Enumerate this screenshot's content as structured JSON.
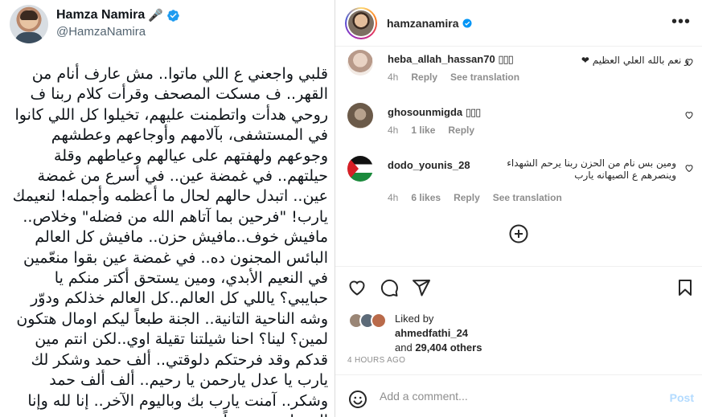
{
  "tweet": {
    "author_name": "Hamza Namira",
    "author_name_emoji": "🎤",
    "handle": "@HamzaNamira",
    "body": "قلبي واجعني ع اللي ماتوا.. مش عارف أنام من القهر.. ف مسكت المصحف وقرأت كلام ربنا ف روحي هدأت واتطمنت عليهم، تخيلوا كل اللي كانوا في المستشفى، بآلامهم وأوجاعهم وعطشهم وجوعهم ولهفتهم على عيالهم وعياطهم وقلة حيلتهم.. في غمضة عين.. في أسرع من غمضة عين.. اتبدل حالهم لحال ما أعظمه وأجمله! لنعيمك يارب! \"فرحين بما آتاهم الله من فضله\" وخلاص.. مافيش خوف..مافيش حزن.. مافيش كل العالم البائس المجنون ده.. في غمضة عين بقوا منعّمين في النعيم الأبدي، ومين يستحق أكتر منكم يا حبايبي؟ ياللي كل العالم..كل العالم خذلكم ودوّر وشه الناحية التانية.. الجنة طبعاً ليكم اومال هتكون لمين؟ لينا؟ احنا شيلتنا تقيلة اوي..لكن انتم مين قدكم وقد فرحتكم دلوقتي.. ألف حمد وشكر لك يارب يا عدل يارحمن يا رحيم.. ألف ألف حمد وشكر.. آمنت يارب بك وباليوم الآخر.. إنا لله وإنا إليه راجعون يقيناً"
  },
  "instagram": {
    "username": "hamzanamira",
    "more_icon": "more-horizontal-icon",
    "comments": [
      {
        "user": "heba_allah_hassan70",
        "text": "و نعم بالله العلي العظيم ❤",
        "time": "4h",
        "likes": "",
        "reply": "Reply",
        "translate": "See translation"
      },
      {
        "user": "ghosounmigda",
        "text": "",
        "time": "4h",
        "likes": "1 like",
        "reply": "Reply",
        "translate": ""
      },
      {
        "user": "dodo_younis_28",
        "text": "ومين بس نام من الحزن ربنا يرحم الشهداء وينصرهم ع الصيهانه يارب",
        "time": "4h",
        "likes": "6 likes",
        "reply": "Reply",
        "translate": "See translation"
      }
    ],
    "liked_by_label": "Liked by",
    "liked_by_user": "ahmedfathi_24",
    "liked_by_and": "and",
    "liked_by_others": "29,404 others",
    "timestamp": "4 HOURS AGO",
    "add_comment_placeholder": "Add a comment...",
    "post_label": "Post",
    "colors": {
      "verified": "#0095f6",
      "post_disabled": "#b3dbff",
      "meta": "#8e8e8e"
    }
  }
}
